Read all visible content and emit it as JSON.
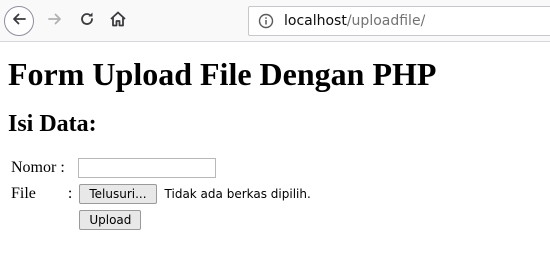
{
  "browser": {
    "url_host": "localhost",
    "url_path": "/uploadfile/",
    "icons": {
      "back": "back-arrow-icon",
      "forward": "forward-arrow-icon",
      "reload": "reload-icon",
      "home": "home-icon",
      "info": "info-icon"
    }
  },
  "page": {
    "title": "Form Upload File Dengan PHP",
    "section_title": "Isi Data:",
    "form": {
      "nomor_label": "Nomor",
      "nomor_colon": ":",
      "nomor_value": "",
      "file_label": "File",
      "file_colon": ":",
      "browse_button": "Telusuri...",
      "file_status": "Tidak ada berkas dipilih.",
      "upload_button": "Upload"
    }
  }
}
